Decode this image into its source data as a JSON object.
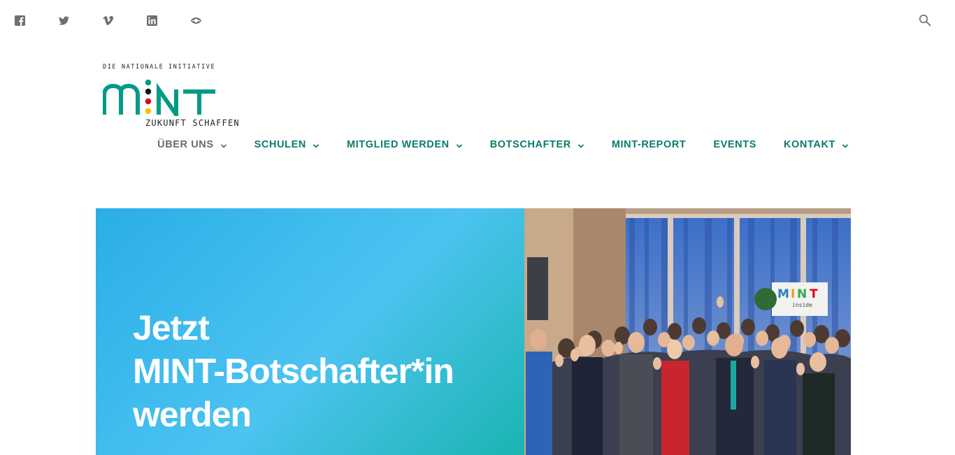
{
  "social": [
    {
      "name": "facebook-icon"
    },
    {
      "name": "twitter-icon"
    },
    {
      "name": "vimeo-icon"
    },
    {
      "name": "linkedin-icon"
    },
    {
      "name": "issuu-icon"
    }
  ],
  "logo": {
    "tagline": "DIE NATIONALE INITIATIVE",
    "wordmark": "MINT",
    "subline": "ZUKUNFT SCHAFFEN",
    "colors": {
      "teal": "#009a86",
      "black": "#111111",
      "red": "#e2001a",
      "gold": "#f5c400"
    }
  },
  "nav": {
    "items": [
      {
        "label": "ÜBER UNS",
        "dropdown": true,
        "active": true
      },
      {
        "label": "SCHULEN",
        "dropdown": true,
        "active": false
      },
      {
        "label": "MITGLIED WERDEN",
        "dropdown": true,
        "active": false
      },
      {
        "label": "BOTSCHAFTER",
        "dropdown": true,
        "active": false
      },
      {
        "label": "MINT-REPORT",
        "dropdown": false,
        "active": false
      },
      {
        "label": "EVENTS",
        "dropdown": false,
        "active": false
      },
      {
        "label": "KONTAKT",
        "dropdown": true,
        "active": false
      }
    ],
    "color": "#0a7c6b",
    "active_color": "#6a6a6a"
  },
  "hero": {
    "title_lines": [
      "Jetzt",
      "MINT-Botschafter*in",
      "werden"
    ],
    "photo_sign": "inside"
  }
}
